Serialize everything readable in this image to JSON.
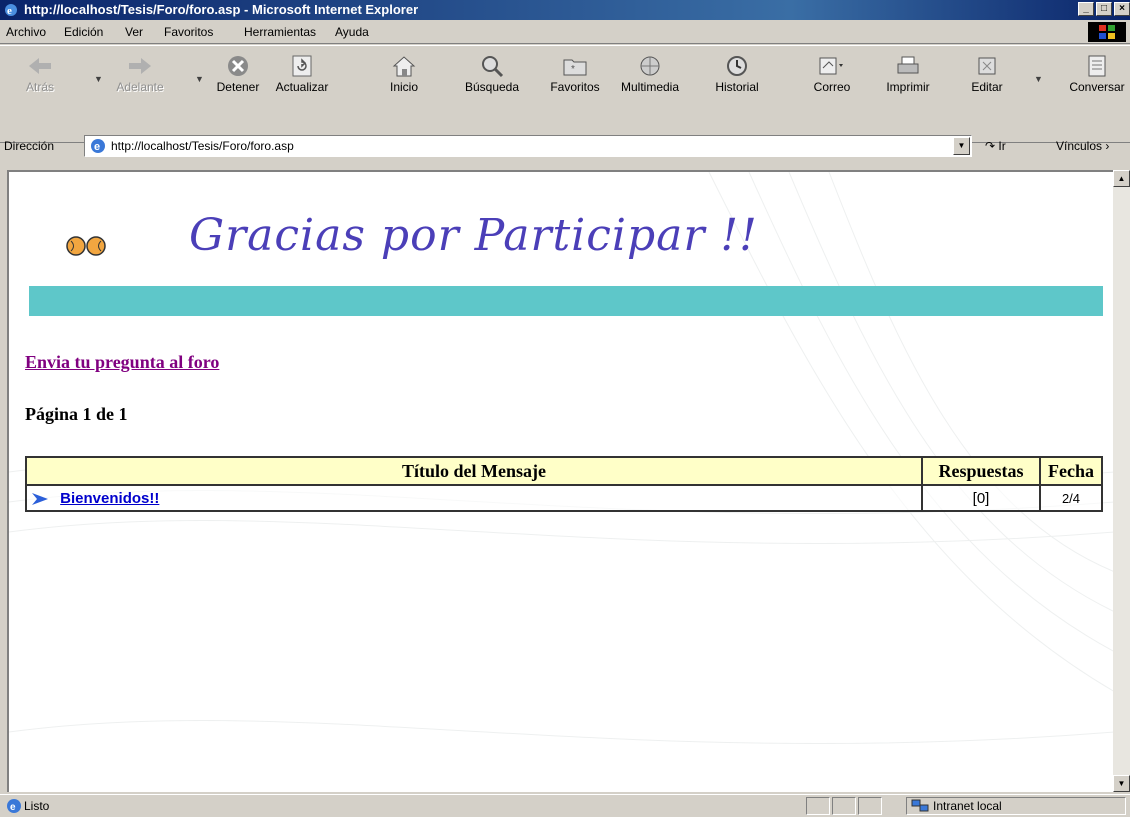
{
  "window": {
    "title": "http://localhost/Tesis/Foro/foro.asp - Microsoft Internet Explorer",
    "buttons": {
      "minimize": "_",
      "maximize": "□",
      "close": "×"
    }
  },
  "menu": {
    "items": [
      "Archivo",
      "Edición",
      "Ver",
      "Favoritos",
      "Herramientas",
      "Ayuda"
    ]
  },
  "toolbar": {
    "back": "Atrás",
    "forward": "Adelante",
    "stop": "Detener",
    "refresh": "Actualizar",
    "home": "Inicio",
    "search": "Búsqueda",
    "favorites": "Favoritos",
    "media": "Multimedia",
    "history": "Historial",
    "mail": "Correo",
    "print": "Imprimir",
    "edit": "Editar",
    "discuss": "Conversar"
  },
  "address": {
    "label": "Dirección",
    "url": "http://localhost/Tesis/Foro/foro.asp",
    "go": "Ir",
    "links": "Vínculos"
  },
  "page": {
    "banner": "Gracias por Participar !!",
    "post_link": "Envia tu pregunta al foro",
    "page_info": "Página 1 de 1",
    "table": {
      "headers": [
        "Título del Mensaje",
        "Respuestas",
        "Fecha"
      ],
      "rows": [
        {
          "title": "Bienvenidos!!",
          "replies": "[0]",
          "date": "2/4"
        }
      ]
    },
    "colors": {
      "accent_bar": "#5ec7c9",
      "header_bg": "#ffffc8",
      "banner_text": "#4b3fb8"
    }
  },
  "status": {
    "text": "Listo",
    "zone": "Intranet local"
  }
}
